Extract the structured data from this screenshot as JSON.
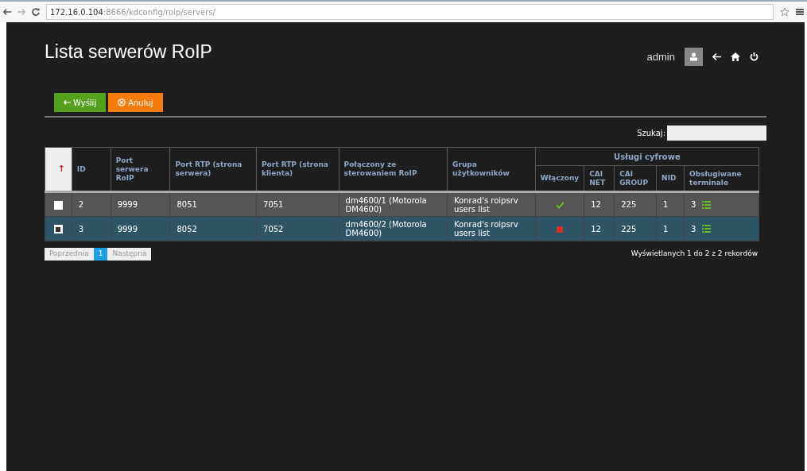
{
  "browser": {
    "url_host": "172.16.0.104",
    "url_path": ":8666/kdconfig/roip/servers/"
  },
  "header": {
    "title": "Lista serwerów RoIP",
    "user": "admin"
  },
  "buttons": [
    {
      "label": "Wyślij",
      "kind": "send"
    },
    {
      "label": "Anuluj",
      "kind": "cancel"
    }
  ],
  "search": {
    "label": "Szukaj:"
  },
  "table": {
    "sort_mark": "↑",
    "group_heading": "Usługi cyfrowe",
    "columns": [
      "ID",
      "Port serwera RoIP",
      "Port RTP (strona serwera)",
      "Port RTP (strona klienta)",
      "Połączony ze sterowaniem RoIP",
      "Grupa użytkowników"
    ],
    "sub_columns": [
      "Włączony",
      "CAI NET",
      "CAI GROUP",
      "NID",
      "Obsługiwane terminale"
    ],
    "rows": [
      {
        "selected": false,
        "id": "2",
        "port": "9999",
        "rtp_server": "8051",
        "rtp_client": "7051",
        "connected": "dm4600/1 (Motorola DM4600)",
        "group": "Konrad's roipsrv users list",
        "enabled": true,
        "cai_net": "12",
        "cai_group": "225",
        "nid": "1",
        "terminals": "3"
      },
      {
        "selected": true,
        "id": "3",
        "port": "9999",
        "rtp_server": "8052",
        "rtp_client": "7052",
        "connected": "dm4600/2 (Motorola DM4600)",
        "group": "Konrad's roipsrv users list",
        "enabled": false,
        "cai_net": "12",
        "cai_group": "225",
        "nid": "1",
        "terminals": "3"
      }
    ]
  },
  "pagination": {
    "items": [
      {
        "label": "Poprzednia",
        "selected": false
      },
      {
        "label": "1",
        "selected": true
      },
      {
        "label": "Następna",
        "selected": false
      }
    ]
  },
  "info": "Wyświetlanych 1 do 2 z 2 rekordów"
}
